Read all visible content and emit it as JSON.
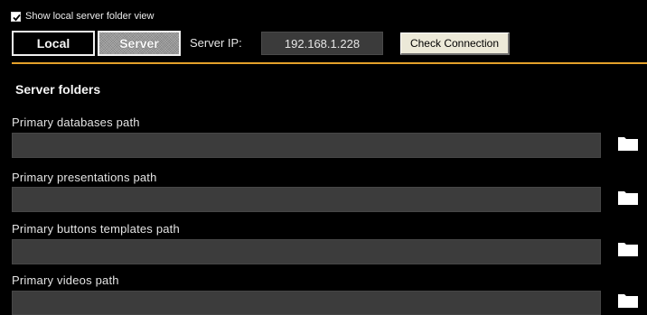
{
  "header": {
    "show_local_label": "Show local server folder view",
    "show_local_checked": true,
    "local_button": "Local",
    "server_button": "Server",
    "server_ip_label": "Server IP:",
    "server_ip_value": "192.168.1.228",
    "check_connection_button": "Check Connection"
  },
  "colors": {
    "background": "#000000",
    "divider": "#e4a12a",
    "field": "#3c3c3c"
  },
  "server_folders": {
    "title": "Server folders",
    "paths": [
      {
        "label": "Primary databases path",
        "value": "",
        "icon": "folder-icon"
      },
      {
        "label": "Primary presentations path",
        "value": "",
        "icon": "folder-icon"
      },
      {
        "label": "Primary buttons templates path",
        "value": "",
        "icon": "folder-icon"
      },
      {
        "label": "Primary videos path",
        "value": "",
        "icon": "folder-icon"
      }
    ]
  }
}
